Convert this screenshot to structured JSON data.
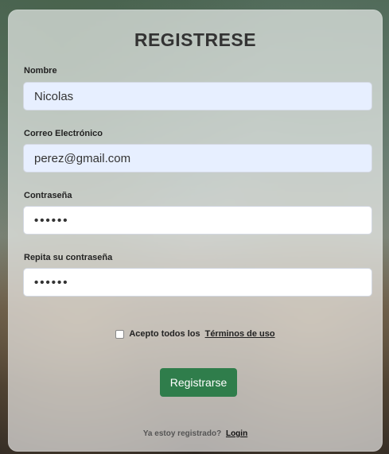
{
  "page": {
    "title": "REGISTRESE"
  },
  "form": {
    "nombre": {
      "label": "Nombre",
      "value": "Nicolas"
    },
    "correo": {
      "label": "Correo Electrónico",
      "value": "perez@gmail.com"
    },
    "contrasena": {
      "label": "Contraseña",
      "value": "••••••"
    },
    "repita": {
      "label": "Repita su contraseña",
      "value": "••••••"
    }
  },
  "terms": {
    "text": "Acepto todos los",
    "link": "Términos de uso"
  },
  "actions": {
    "register_label": "Registrarse"
  },
  "footer": {
    "text": "Ya estoy registrado?",
    "login_link": "Login"
  }
}
